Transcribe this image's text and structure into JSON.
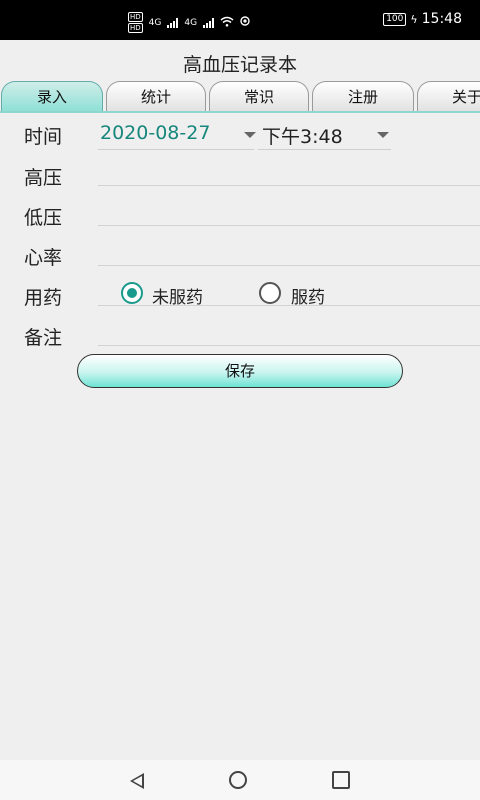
{
  "status_bar": {
    "left_chips": [
      "HD",
      "HD"
    ],
    "network_1": "4G",
    "network_2": "4G",
    "battery": "100",
    "time": "15:48"
  },
  "app": {
    "title": "高血压记录本"
  },
  "tabs": [
    {
      "label": "录入",
      "active": true
    },
    {
      "label": "统计",
      "active": false
    },
    {
      "label": "常识",
      "active": false
    },
    {
      "label": "注册",
      "active": false
    },
    {
      "label": "关于",
      "active": false
    }
  ],
  "form": {
    "time_label": "时间",
    "date_value": "2020-08-27",
    "time_value": "下午3:48",
    "high_label": "高压",
    "high_value": "",
    "low_label": "低压",
    "low_value": "",
    "heart_label": "心率",
    "heart_value": "",
    "med_label": "用药",
    "med_options": [
      {
        "label": "未服药",
        "checked": true
      },
      {
        "label": "服药",
        "checked": false
      }
    ],
    "note_label": "备注",
    "note_value": "",
    "save_label": "保存"
  },
  "colors": {
    "accent": "#17877c",
    "tab_active": "#8fe0d6"
  },
  "nav": {
    "icons": [
      "back-icon",
      "home-icon",
      "recents-icon"
    ]
  }
}
